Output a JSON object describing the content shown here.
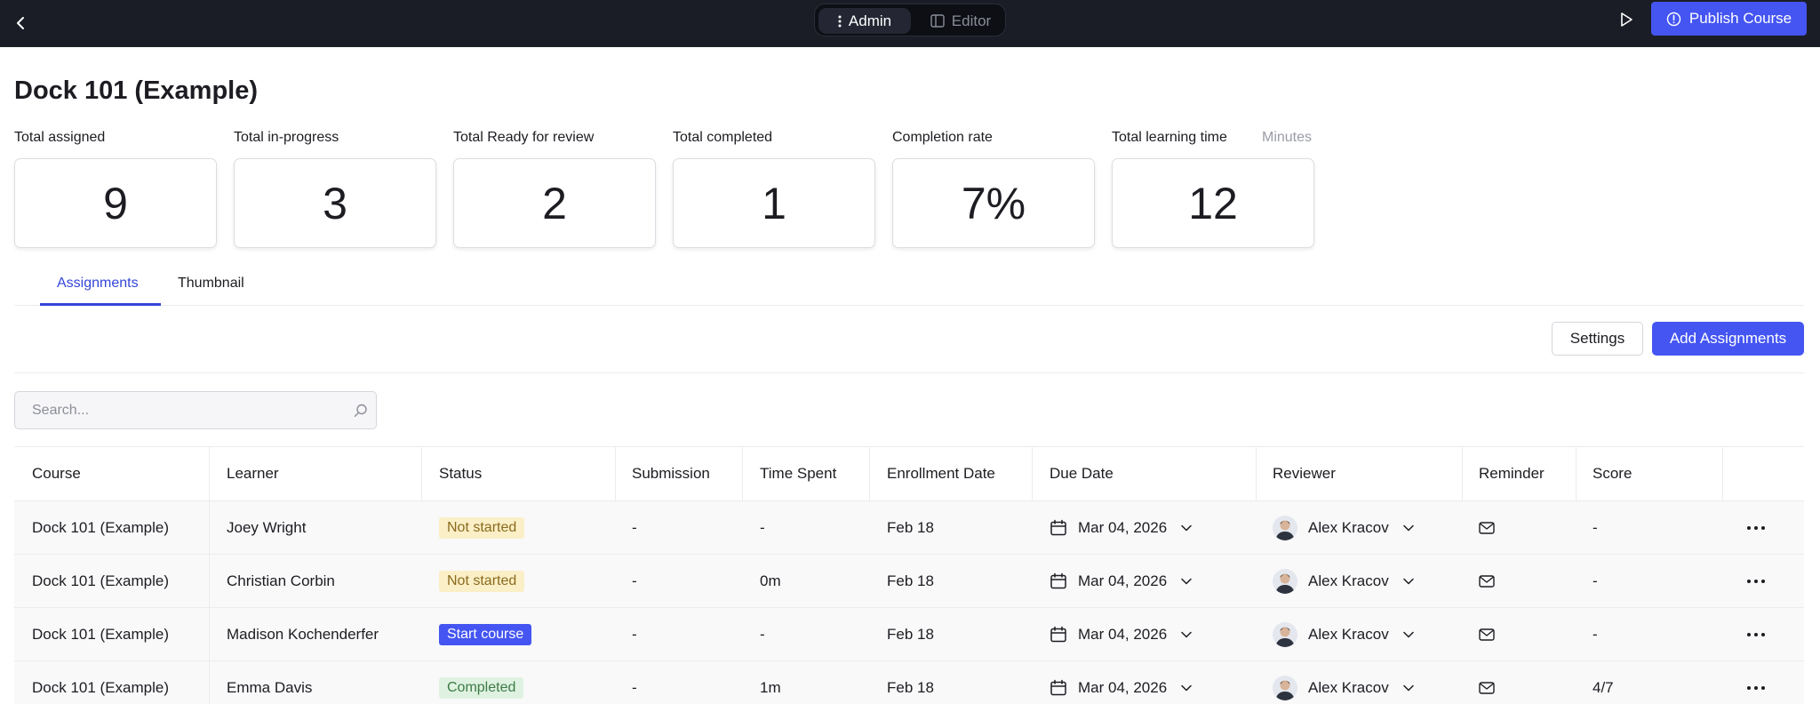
{
  "header": {
    "modes": {
      "admin": "Admin",
      "editor": "Editor"
    },
    "publish_label": "Publish Course"
  },
  "page": {
    "title": "Dock 101 (Example)"
  },
  "stats": [
    {
      "label": "Total assigned",
      "value": "9"
    },
    {
      "label": "Total in-progress",
      "value": "3"
    },
    {
      "label": "Total Ready for review",
      "value": "2"
    },
    {
      "label": "Total completed",
      "value": "1"
    },
    {
      "label": "Completion rate",
      "value": "7%"
    },
    {
      "label": "Total learning time",
      "value": "12",
      "unit": "Minutes"
    }
  ],
  "tabs": [
    {
      "label": "Assignments",
      "active": true
    },
    {
      "label": "Thumbnail",
      "active": false
    }
  ],
  "actions": {
    "settings": "Settings",
    "add": "Add Assignments"
  },
  "search": {
    "placeholder": "Search..."
  },
  "table": {
    "columns": [
      "Course",
      "Learner",
      "Status",
      "Submission",
      "Time Spent",
      "Enrollment Date",
      "Due Date",
      "Reviewer",
      "Reminder",
      "Score"
    ],
    "rows": [
      {
        "course": "Dock 101 (Example)",
        "learner": "Joey Wright",
        "status": "Not started",
        "submission": "-",
        "time_spent": "-",
        "enrollment": "Feb 18",
        "due": "Mar 04, 2026",
        "reviewer": "Alex Kracov",
        "score": "-"
      },
      {
        "course": "Dock 101 (Example)",
        "learner": "Christian Corbin",
        "status": "Not started",
        "submission": "-",
        "time_spent": "0m",
        "enrollment": "Feb 18",
        "due": "Mar 04, 2026",
        "reviewer": "Alex Kracov",
        "score": "-"
      },
      {
        "course": "Dock 101 (Example)",
        "learner": "Madison Kochenderfer",
        "status": "Start course",
        "submission": "-",
        "time_spent": "-",
        "enrollment": "Feb 18",
        "due": "Mar 04, 2026",
        "reviewer": "Alex Kracov",
        "score": "-"
      },
      {
        "course": "Dock 101 (Example)",
        "learner": "Emma Davis",
        "status": "Completed",
        "submission": "-",
        "time_spent": "1m",
        "enrollment": "Feb 18",
        "due": "Mar 04, 2026",
        "reviewer": "Alex Kracov",
        "score": "4/7"
      }
    ]
  },
  "colors": {
    "topbar": "#1b1d26",
    "accent": "#4455f2",
    "tab_active": "#3346d8",
    "status_not_started": "#fbefc7",
    "status_completed": "#dff2e1"
  }
}
